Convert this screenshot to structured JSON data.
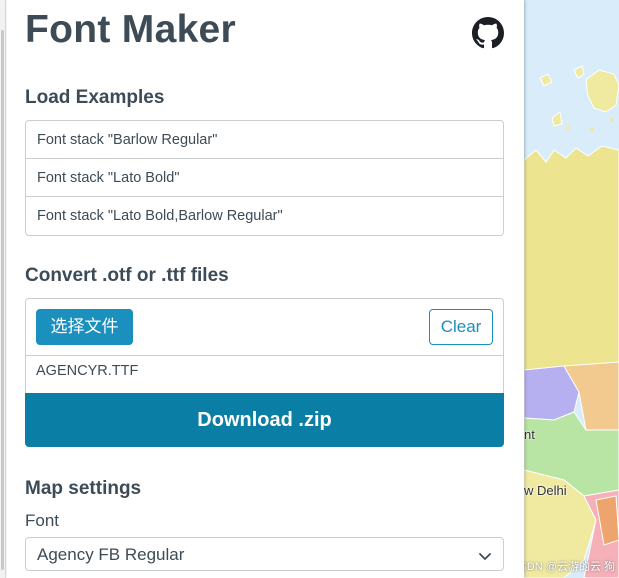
{
  "app": {
    "title": "Font Maker",
    "github_icon": "github-icon"
  },
  "examples": {
    "heading": "Load Examples",
    "items": [
      {
        "label": "Font stack \"Barlow Regular\""
      },
      {
        "label": "Font stack \"Lato Bold\""
      },
      {
        "label": "Font stack \"Lato Bold,Barlow Regular\""
      }
    ]
  },
  "convert": {
    "heading": "Convert .otf or .ttf files",
    "choose_label": "选择文件",
    "clear_label": "Clear",
    "file_name": "AGENCYR.TTF",
    "download_label": "Download .zip"
  },
  "map_settings": {
    "heading": "Map settings",
    "font_label": "Font",
    "font_value": "Agency FB Regular"
  },
  "map": {
    "labels": [
      "nt",
      "w Delhi"
    ],
    "watermark": "CSDN @云游的云 狗"
  },
  "colors": {
    "accent": "#1b8fbd",
    "download_bg": "#0a7ea4",
    "heading": "#3d4b56",
    "border": "#c9ced3",
    "map_water": "#d8ecfa"
  }
}
